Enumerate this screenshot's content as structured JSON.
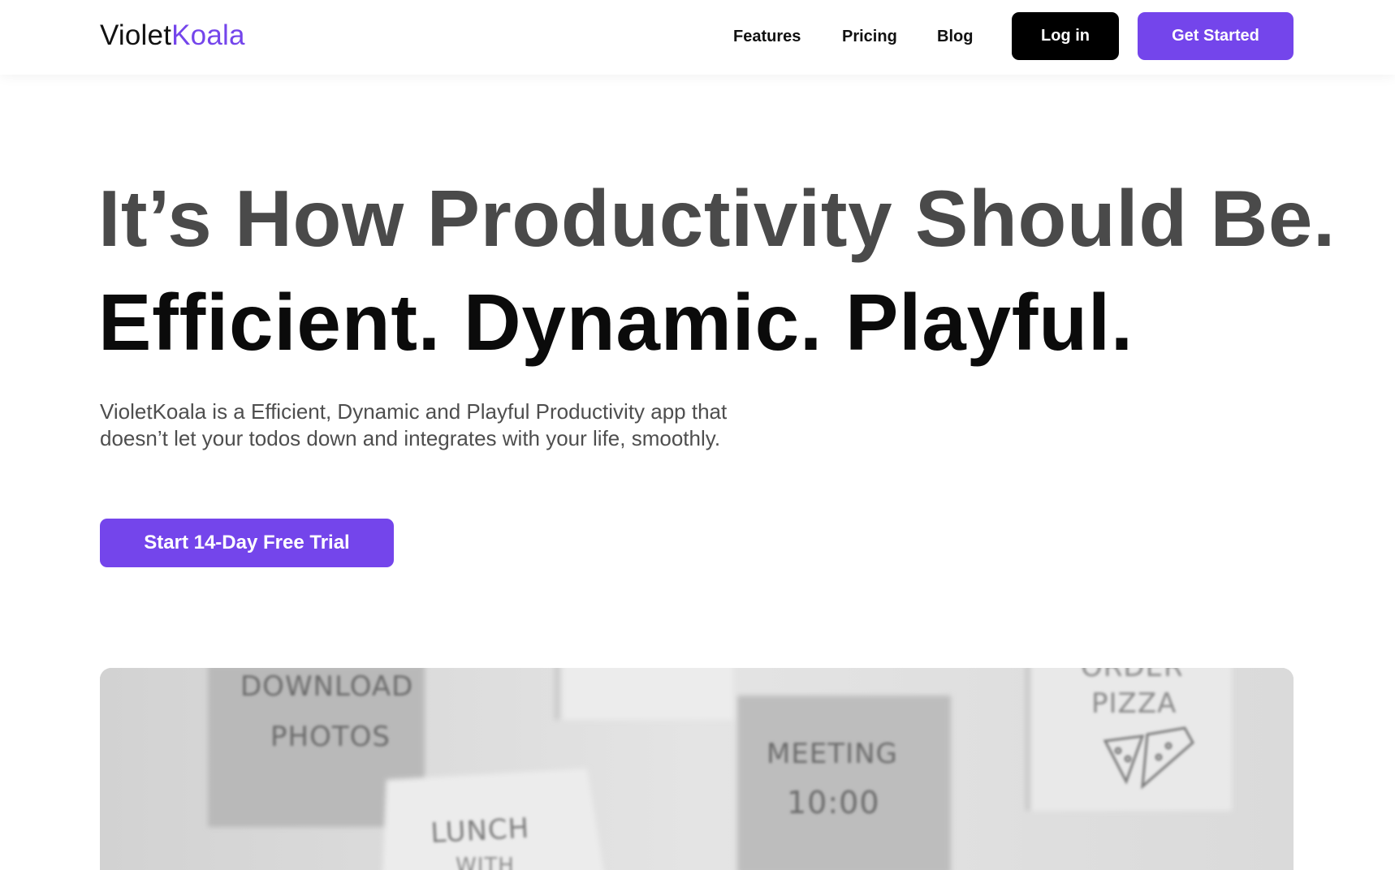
{
  "header": {
    "logo": {
      "part1": "Violet",
      "part2": "Koala"
    },
    "nav": {
      "features": "Features",
      "pricing": "Pricing",
      "blog": "Blog"
    },
    "login_label": "Log in",
    "get_started_label": "Get Started"
  },
  "hero": {
    "headline": "It’s How Productivity Should Be.",
    "tagline": "Efficient. Dynamic. Playful.",
    "description": "VioletKoala is a Efficient, Dynamic and Playful Productivity app that doesn’t let your todos down and integrates with your life, smoothly.",
    "cta_label": "Start 14-Day Free Trial"
  },
  "preview": {
    "notes": {
      "download": [
        "DOWNLOAD",
        "PHOTOS"
      ],
      "meeting": [
        "MEETING",
        "10:00"
      ],
      "pizza": [
        "ORDER",
        "PIZZA"
      ],
      "lunch": [
        "LUNCH",
        "WITH"
      ]
    }
  },
  "colors": {
    "accent": "#7445eb",
    "headline_gray": "#4a4a4a",
    "text_dark": "#0b0b0b",
    "login_bg": "#000000"
  }
}
